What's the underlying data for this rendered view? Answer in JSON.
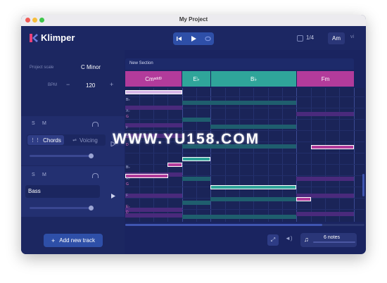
{
  "window": {
    "title": "My Project"
  },
  "app": {
    "name": "Klimper",
    "brand_color": "#e9417a",
    "accent": "#2e4fa8"
  },
  "transport": {
    "prev_icon": "skip-back-icon",
    "play_icon": "play-icon",
    "loop_icon": "loop-icon"
  },
  "header": {
    "time_signature": "1/4",
    "key": "Am",
    "key_mode": "vi"
  },
  "project": {
    "scale_label": "Project scale",
    "scale_value": "C Minor",
    "bpm_label": "BPM",
    "bpm_value": "120",
    "minus": "−",
    "plus": "+"
  },
  "tracks": [
    {
      "solo": "S",
      "mute": "M",
      "tabs": [
        "Chords",
        "Voicing"
      ],
      "active_tab": "Chords",
      "volume": 0.9
    },
    {
      "solo": "S",
      "mute": "M",
      "name": "Bass",
      "volume": 0.95
    }
  ],
  "footer": {
    "add_track_label": "Add new track",
    "notes_count": "6 notes"
  },
  "section": {
    "name": "New Section"
  },
  "chords": [
    {
      "name": "Cm",
      "ext": "add9",
      "color": "#b23b9b"
    },
    {
      "name": "E♭",
      "ext": "",
      "color": "#2fa59a"
    },
    {
      "name": "B♭",
      "ext": "",
      "color": "#2fa59a"
    },
    {
      "name": "Fm",
      "ext": "",
      "color": "#b23b9b"
    }
  ],
  "roll_labels": [
    "B♭",
    "A♭",
    "G",
    "F",
    "E♭",
    "D",
    "B♭",
    "A♭",
    "G",
    "F",
    "E♭",
    "D"
  ],
  "watermark": "WWW.YU158.COM"
}
